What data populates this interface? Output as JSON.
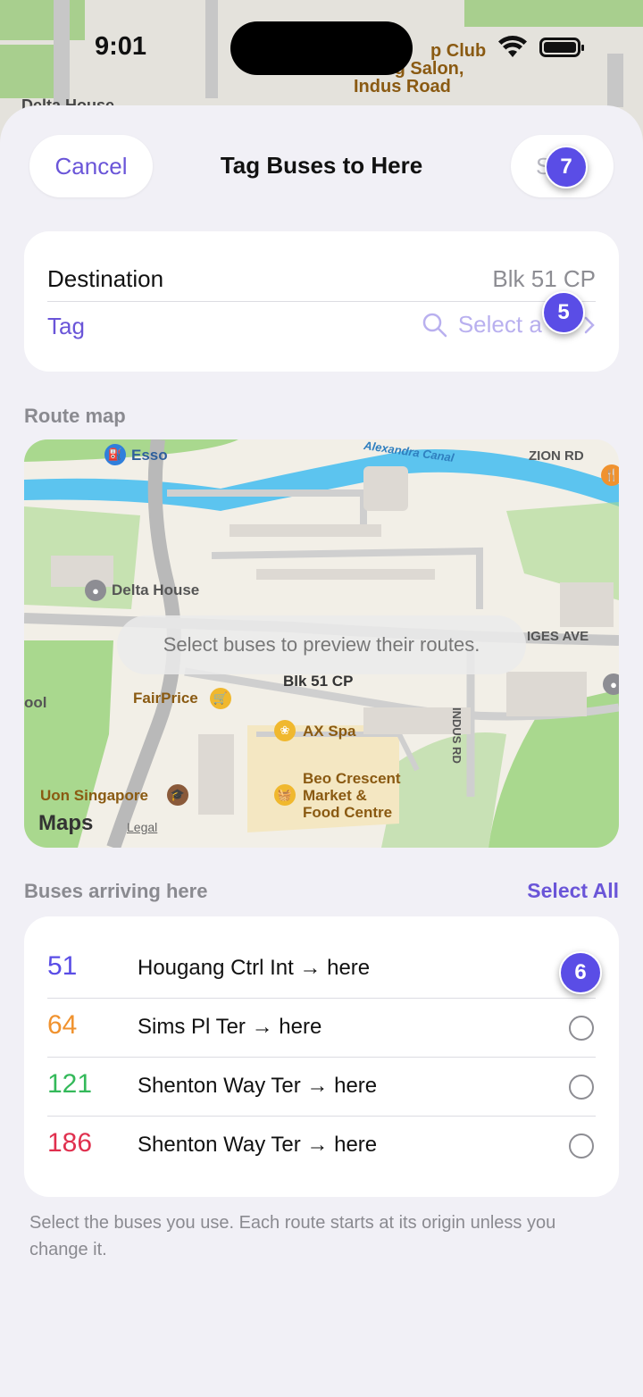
{
  "status_bar": {
    "time": "9:01"
  },
  "background_map": {
    "poi_line1": "p Club",
    "poi_line2": "Dog Salon,",
    "poi_line3": "Indus Road",
    "place_label": "Delta House"
  },
  "header": {
    "cancel_label": "Cancel",
    "title": "Tag Buses to Here",
    "save_label": "S"
  },
  "destination": {
    "label": "Destination",
    "value": "Blk 51 CP",
    "tag_label": "Tag",
    "tag_placeholder": "Select a Ta"
  },
  "route_map": {
    "section_title": "Route map",
    "hint": "Select buses to preview their routes.",
    "labels": {
      "esso": "Esso",
      "canal": "Alexandra Canal",
      "zion": "ZION RD",
      "delta": "Delta House",
      "avenue": "IGES AVE",
      "blk": "Blk 51 CP",
      "school": "ool",
      "fairprice": "FairPrice",
      "axspa": "AX Spa",
      "indus": "INDUS RD",
      "beo1": "Beo Crescent",
      "beo2": "Market &",
      "beo3": "Food Centre",
      "uon": "Uon Singapore",
      "maps": "Maps",
      "legal": "Legal"
    }
  },
  "buses": {
    "section_title": "Buses arriving here",
    "select_all": "Select All",
    "items": [
      {
        "number": "51",
        "route": "Hougang Ctrl Int → here",
        "color": "#5a4de6"
      },
      {
        "number": "64",
        "route": "Sims Pl Ter → here",
        "color": "#f0922e"
      },
      {
        "number": "121",
        "route": "Shenton Way Ter → here",
        "color": "#34b95a"
      },
      {
        "number": "186",
        "route": "Shenton Way Ter → here",
        "color": "#e0304e"
      }
    ],
    "footnote": "Select the buses you use. Each route starts at its origin unless you change it."
  },
  "badges": {
    "b7": "7",
    "b5": "5",
    "b6": "6"
  },
  "colors": {
    "accent": "#6a55d8",
    "badge": "#5a4de6"
  }
}
